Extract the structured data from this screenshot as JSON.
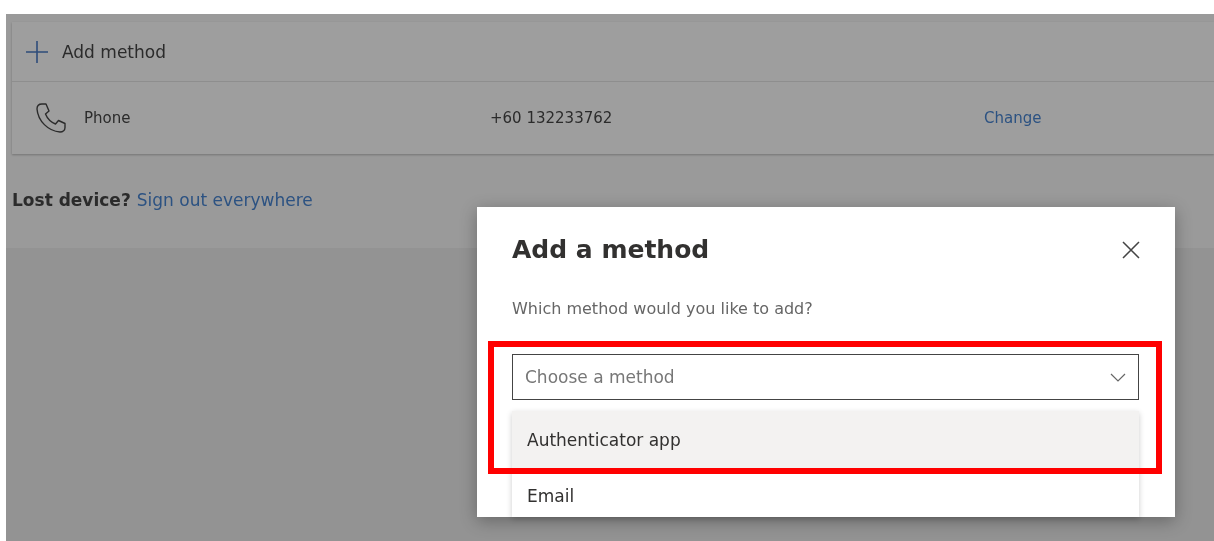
{
  "page": {
    "add_method": {
      "label": "Add method"
    },
    "methods": [
      {
        "name": "Phone",
        "value": "+60 132233762",
        "action": "Change"
      }
    ],
    "lost_device": {
      "text": "Lost device?",
      "link": "Sign out everywhere"
    }
  },
  "dialog": {
    "title": "Add a method",
    "question": "Which method would you like to add?",
    "select": {
      "placeholder": "Choose a method",
      "expanded": true,
      "options": [
        {
          "label": "Authenticator app",
          "selected": true
        },
        {
          "label": "Email",
          "selected": false
        }
      ]
    }
  }
}
